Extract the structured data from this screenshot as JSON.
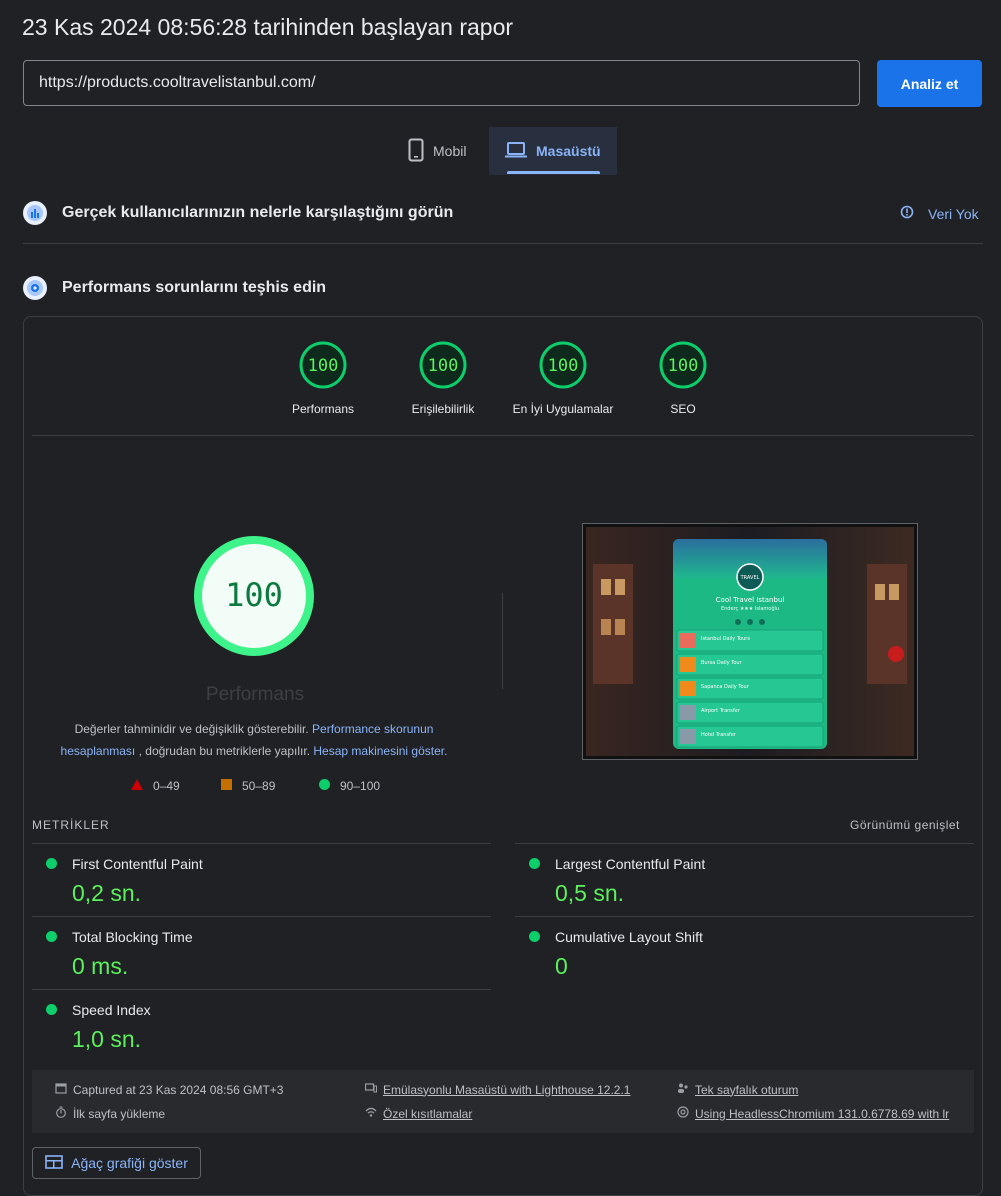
{
  "header": {
    "title": "23 Kas 2024 08:56:28 tarihinden başlayan rapor",
    "url_value": "https://products.cooltravelistanbul.com/",
    "analyze_label": "Analiz et"
  },
  "tabs": [
    {
      "label": "Mobil",
      "icon": "phone-icon",
      "selected": false
    },
    {
      "label": "Masaüstü",
      "icon": "laptop-icon",
      "selected": true
    }
  ],
  "field_data": {
    "title": "Gerçek kullanıcılarınızın nelerle karşılaştığını görün",
    "status_label": "Veri Yok",
    "status_icon": "info-icon"
  },
  "lab": {
    "title": "Performans sorunlarını teşhis edin"
  },
  "categories": [
    {
      "label": "Performans",
      "score": "100",
      "value": 100
    },
    {
      "label": "Erişilebilirlik",
      "score": "100",
      "value": 100
    },
    {
      "label": "En İyi Uygulamalar",
      "score": "100",
      "value": 100
    },
    {
      "label": "SEO",
      "score": "100",
      "value": 100
    }
  ],
  "main_gauge": {
    "score": "100",
    "value": 100,
    "label": "Performans",
    "color": "#0cce6b"
  },
  "description": {
    "t1": "Değerler tahminidir ve değişiklik gösterebilir.",
    "link1": "Performance skorunun hesaplanması",
    "t2": ", doğrudan bu metriklerle yapılır.",
    "link2": "Hesap makinesini göster."
  },
  "legend": [
    {
      "range": "0–49",
      "shape": "triangle",
      "color": "#cc0000"
    },
    {
      "range": "50–89",
      "shape": "square",
      "color": "#c56f00"
    },
    {
      "range": "90–100",
      "shape": "circle",
      "color": "#0cce6b"
    }
  ],
  "screenshot": {
    "site_title": "Cool Travel Istanbul",
    "tagline": "Enderç ★★★ Islamoğlu",
    "items": [
      "Istanbul Daily Tours",
      "Bursa Daily Tour",
      "Sapanca Daily Tour",
      "Airport Transfer",
      "Hotel Transfer"
    ]
  },
  "metrics": {
    "heading": "METRİKLER",
    "expand_label": "Görünümü genişlet",
    "items": [
      {
        "name": "First Contentful Paint",
        "value": "0,2 sn."
      },
      {
        "name": "Largest Contentful Paint",
        "value": "0,5 sn."
      },
      {
        "name": "Total Blocking Time",
        "value": "0 ms."
      },
      {
        "name": "Cumulative Layout Shift",
        "value": "0"
      },
      {
        "name": "Speed Index",
        "value": "1,0 sn."
      }
    ]
  },
  "footer": {
    "captured": "Captured at 23 Kas 2024 08:56 GMT+3",
    "emulation": "Emülasyonlu Masaüstü with Lighthouse 12.2.1",
    "session": "Tek sayfalık oturum",
    "load": "İlk sayfa yükleme",
    "throttling": "Özel kısıtlamalar",
    "browser": "Using HeadlessChromium 131.0.6778.69 with lr"
  },
  "tree_button_label": "Ağaç grafiği göster",
  "colors": {
    "accent": "#8ab4f8",
    "primary_button": "#1a73e8",
    "pass": "#0cce6b",
    "pass_text": "#5cf05c"
  }
}
